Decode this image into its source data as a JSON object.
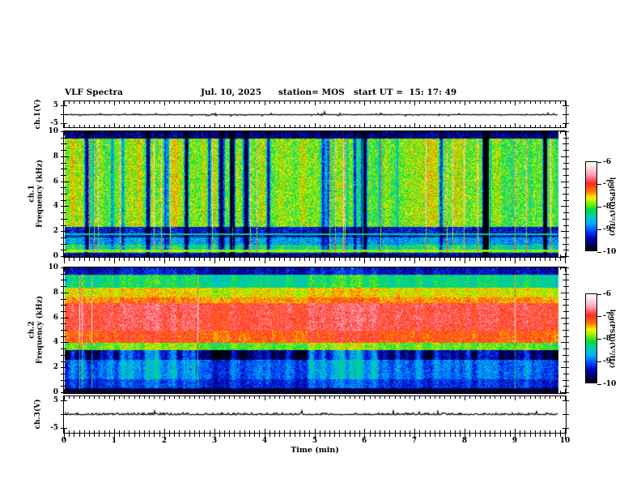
{
  "header": {
    "title": "VLF Spectra",
    "date": "Jul. 10, 2025",
    "station": "station= MOS",
    "start_ut": "start UT =  15: 17: 49"
  },
  "x_axis": {
    "label": "Time (min)",
    "ticks": [
      "0",
      "1",
      "2",
      "3",
      "4",
      "5",
      "6",
      "7",
      "8",
      "9",
      "10"
    ]
  },
  "panels": {
    "ch1_waveform": {
      "ylabel": "ch.1(V)",
      "yticks": [
        "5",
        "-5"
      ]
    },
    "ch1_spectrogram": {
      "ylabel_line1": "ch.1",
      "ylabel_line2": "Frequency (kHz)",
      "yticks": [
        "10",
        "8",
        "6",
        "4",
        "2",
        "0"
      ]
    },
    "ch2_spectrogram": {
      "ylabel_line1": "ch.2",
      "ylabel_line2": "Frequency (kHz)",
      "yticks": [
        "10",
        "8",
        "6",
        "4",
        "2",
        "0"
      ]
    },
    "ch3_waveform": {
      "ylabel": "ch.3(V)",
      "yticks": [
        "5",
        "-5"
      ]
    }
  },
  "colorbars": {
    "unit_label": "log(PSD)(V²/Hz)",
    "ticks": [
      "-6",
      "-7",
      "-8",
      "-9",
      "-10"
    ]
  },
  "chart_data": {
    "type": "heatmap",
    "title": "VLF Spectra",
    "subtitle": "Jul. 10, 2025  station= MOS  start UT = 15:17:49",
    "x": {
      "label": "Time (min)",
      "range": [
        0,
        10
      ],
      "units": "min",
      "data_extent": [
        0,
        9.85
      ]
    },
    "colorscale": {
      "label": "log(PSD)(V²/Hz)",
      "range": [
        -10,
        -6
      ],
      "ticks": [
        -6,
        -7,
        -8,
        -9,
        -10
      ],
      "stops": [
        {
          "t": 0.0,
          "c": "#000000"
        },
        {
          "t": 0.07,
          "c": "#000066"
        },
        {
          "t": 0.14,
          "c": "#0000bb"
        },
        {
          "t": 0.22,
          "c": "#0044ff"
        },
        {
          "t": 0.3,
          "c": "#00aaff"
        },
        {
          "t": 0.38,
          "c": "#00ccbb"
        },
        {
          "t": 0.46,
          "c": "#00dd44"
        },
        {
          "t": 0.53,
          "c": "#88ee00"
        },
        {
          "t": 0.6,
          "c": "#ffee00"
        },
        {
          "t": 0.67,
          "c": "#ff7700"
        },
        {
          "t": 0.76,
          "c": "#ff2a2a"
        },
        {
          "t": 0.85,
          "c": "#ff9aa8"
        },
        {
          "t": 0.93,
          "c": "#ffd8e0"
        },
        {
          "t": 1.0,
          "c": "#ffffff"
        }
      ]
    },
    "panels": [
      {
        "id": "ch1_waveform",
        "type": "line",
        "ylabel": "ch.1(V)",
        "yrange": [
          -6.5,
          6.5
        ],
        "yticks": [
          5,
          -5
        ],
        "baseline": 0,
        "character": "flat near 0 V with sparse small impulsive spikes, trace ends at 9.85 min"
      },
      {
        "id": "ch1_spectrogram",
        "type": "spectrogram",
        "ylabel": [
          "ch.1",
          "Frequency (kHz)"
        ],
        "yrange": [
          0,
          10
        ],
        "yticks": [
          10,
          8,
          6,
          4,
          2,
          0
        ],
        "column_modulation": {
          "gap_threshold": 0.38,
          "gap_depth": 3.0,
          "gain": 0.9,
          "spike_prob": 0.035,
          "spike_gain": 1.5,
          "noise": 1.0,
          "slow_gain": 0.3,
          "centered": false
        },
        "bands": [
          {
            "f": [
              9.45,
              10.01
            ],
            "psd": -9.7,
            "mod": 0.25
          },
          {
            "f": [
              2.4,
              9.45
            ],
            "psd": -8.15,
            "mod": 1.0
          },
          {
            "f": [
              1.55,
              2.4
            ],
            "psd": -9.45,
            "mod": 0.35
          },
          {
            "f": [
              0.95,
              1.55
            ],
            "psd": -8.9,
            "mod": 0.6
          },
          {
            "f": [
              0.3,
              0.95
            ],
            "psd": -8.5,
            "mod": 0.7
          },
          {
            "f": [
              0,
              0.3
            ],
            "psd": -9.6,
            "mod": 0.2
          }
        ],
        "lines": [
          {
            "f": 1.78,
            "psd": -8.45
          },
          {
            "f": 0.45,
            "psd": -7.9
          }
        ]
      },
      {
        "id": "ch2_spectrogram",
        "type": "spectrogram",
        "ylabel": [
          "ch.2",
          "Frequency (kHz)"
        ],
        "yrange": [
          0,
          10
        ],
        "yticks": [
          10,
          8,
          6,
          4,
          2,
          0
        ],
        "column_modulation": {
          "gap_threshold": 0,
          "gap_depth": 0,
          "gain": 0.9,
          "spike_prob": 0.015,
          "spike_gain": 0.9,
          "noise": 0.75,
          "slow_gain": 0.5,
          "centered": true
        },
        "bands": [
          {
            "f": [
              9.45,
              10.01
            ],
            "psd": -9.35,
            "mod": 0.5
          },
          {
            "f": [
              8.4,
              9.45
            ],
            "psd": -8.25,
            "mod": 0.5
          },
          {
            "f": [
              7.6,
              8.4
            ],
            "psd": -7.6,
            "mod": 0.4
          },
          {
            "f": [
              7.2,
              7.6
            ],
            "psd": -7.3,
            "mod": 0.35
          },
          {
            "f": [
              5.0,
              7.2
            ],
            "psd": -6.85,
            "mod": 0.35
          },
          {
            "f": [
              4.0,
              5.0
            ],
            "psd": -7.1,
            "mod": 0.4
          },
          {
            "f": [
              3.4,
              4.0
            ],
            "psd": -7.9,
            "mod": 0.5
          },
          {
            "f": [
              2.6,
              3.4
            ],
            "psd": -9.3,
            "mod": 1.6
          },
          {
            "f": [
              1.1,
              2.6
            ],
            "psd": -8.85,
            "mod": 0.9
          },
          {
            "f": [
              0.35,
              1.1
            ],
            "psd": -9.15,
            "mod": 0.6
          },
          {
            "f": [
              0,
              0.35
            ],
            "psd": -9.85,
            "mod": 0.2
          }
        ],
        "lines": []
      },
      {
        "id": "ch3_waveform",
        "type": "line",
        "ylabel": "ch.3(V)",
        "yrange": [
          -6.5,
          6.5
        ],
        "yticks": [
          5,
          -5
        ],
        "baseline": 0,
        "character": "flat near 0 V with dense tiny positive impulses, trace ends at 9.85 min"
      }
    ]
  }
}
